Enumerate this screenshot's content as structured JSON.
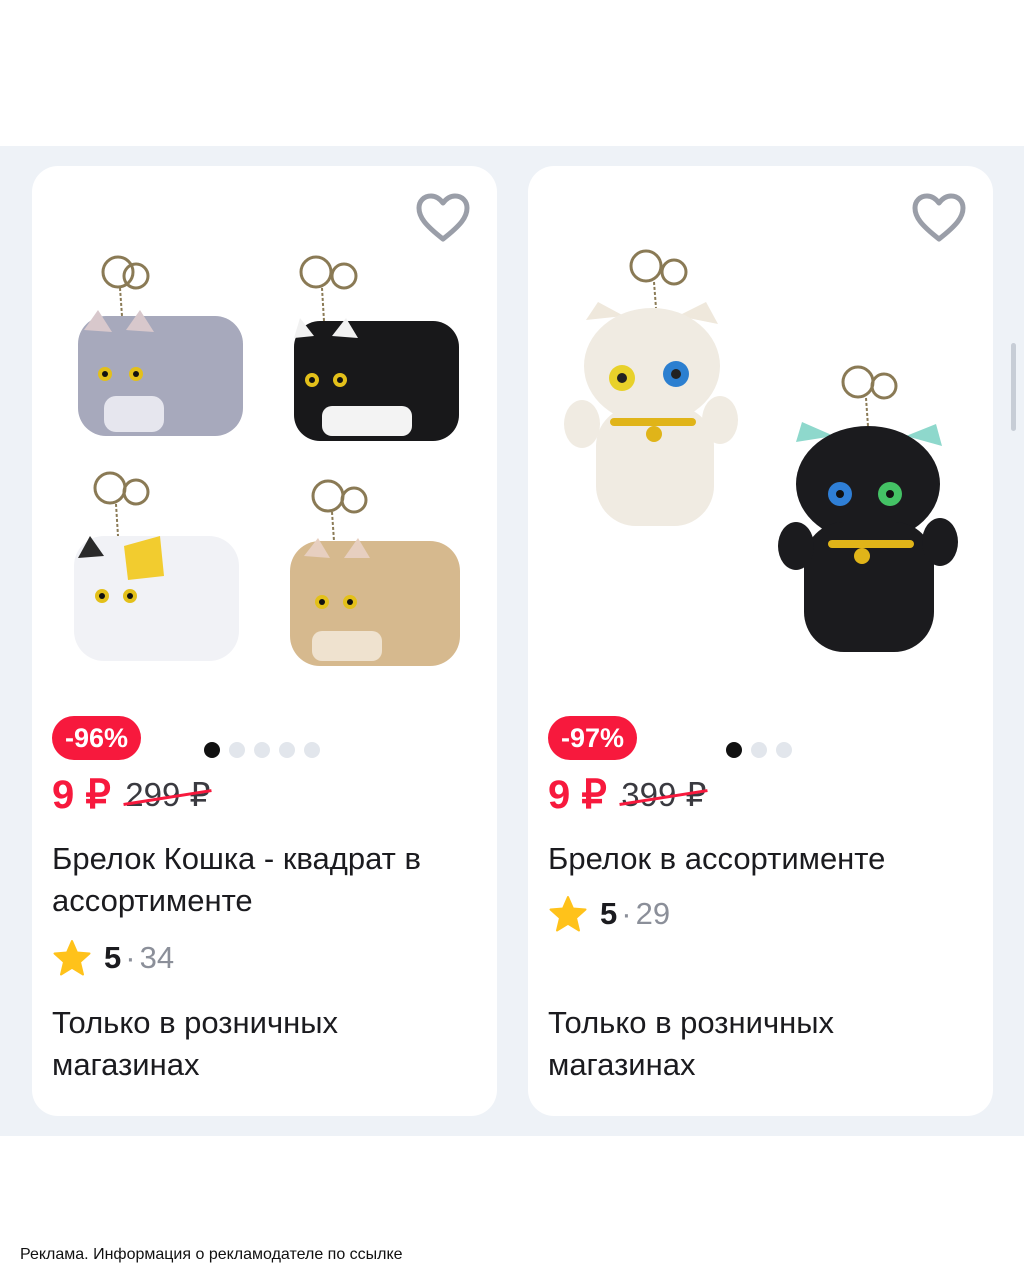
{
  "products": [
    {
      "discount": "-96%",
      "price": "9 ₽",
      "old_price": "299 ₽",
      "title": "Брелок Кошка - квадрат в ассортименте",
      "rating": "5",
      "separator": "·",
      "reviews": "34",
      "availability": "Только в розничных магазинах",
      "image_slides": 5,
      "active_slide": 1
    },
    {
      "discount": "-97%",
      "price": "9 ₽",
      "old_price": "399 ₽",
      "title": "Брелок в ассортименте",
      "rating": "5",
      "separator": "·",
      "reviews": "29",
      "availability": "Только в розничных магазинах",
      "image_slides": 3,
      "active_slide": 1
    }
  ],
  "footer": {
    "ad_text": "Реклама. Информация о рекламодателе по ссылке"
  },
  "colors": {
    "accent_red": "#f7193d",
    "background_band": "#eef2f7",
    "star_yellow": "#ffc21a"
  },
  "icons": {
    "favorite": "heart-outline-icon",
    "rating": "star-icon"
  }
}
